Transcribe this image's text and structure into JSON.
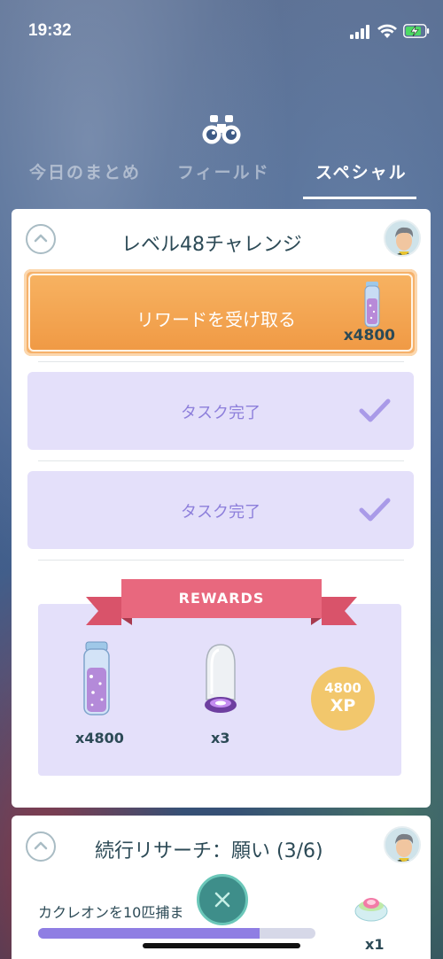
{
  "status_bar": {
    "time": "19:32"
  },
  "tabs": [
    {
      "label": "今日のまとめ",
      "active": false
    },
    {
      "label": "フィールド",
      "active": false
    },
    {
      "label": "スペシャル",
      "active": true
    }
  ],
  "challenge": {
    "title": "レベル48チャレンジ",
    "reward_button": {
      "label": "リワードを受け取る",
      "count": "x4800"
    },
    "tasks": [
      {
        "label": "タスク完了",
        "done": true
      },
      {
        "label": "タスク完了",
        "done": true
      }
    ],
    "rewards": {
      "banner": "REWARDS",
      "items": [
        {
          "icon": "stardust-icon",
          "count": "x4800"
        },
        {
          "icon": "lure-module-icon",
          "count": "x3"
        },
        {
          "icon": "xp-icon",
          "amount": "4800",
          "unit": "XP"
        }
      ]
    }
  },
  "research": {
    "title": "続行リサーチ：願い (3/6)",
    "task_label": "カクレオンを10匹捕ま",
    "progress": 0.8,
    "reward_count": "x1"
  },
  "colors": {
    "accent_purple": "#8f7ee3",
    "reward_orange": "#f09a45",
    "banner_pink": "#e8687e",
    "xp_gold": "#f2c76c"
  }
}
